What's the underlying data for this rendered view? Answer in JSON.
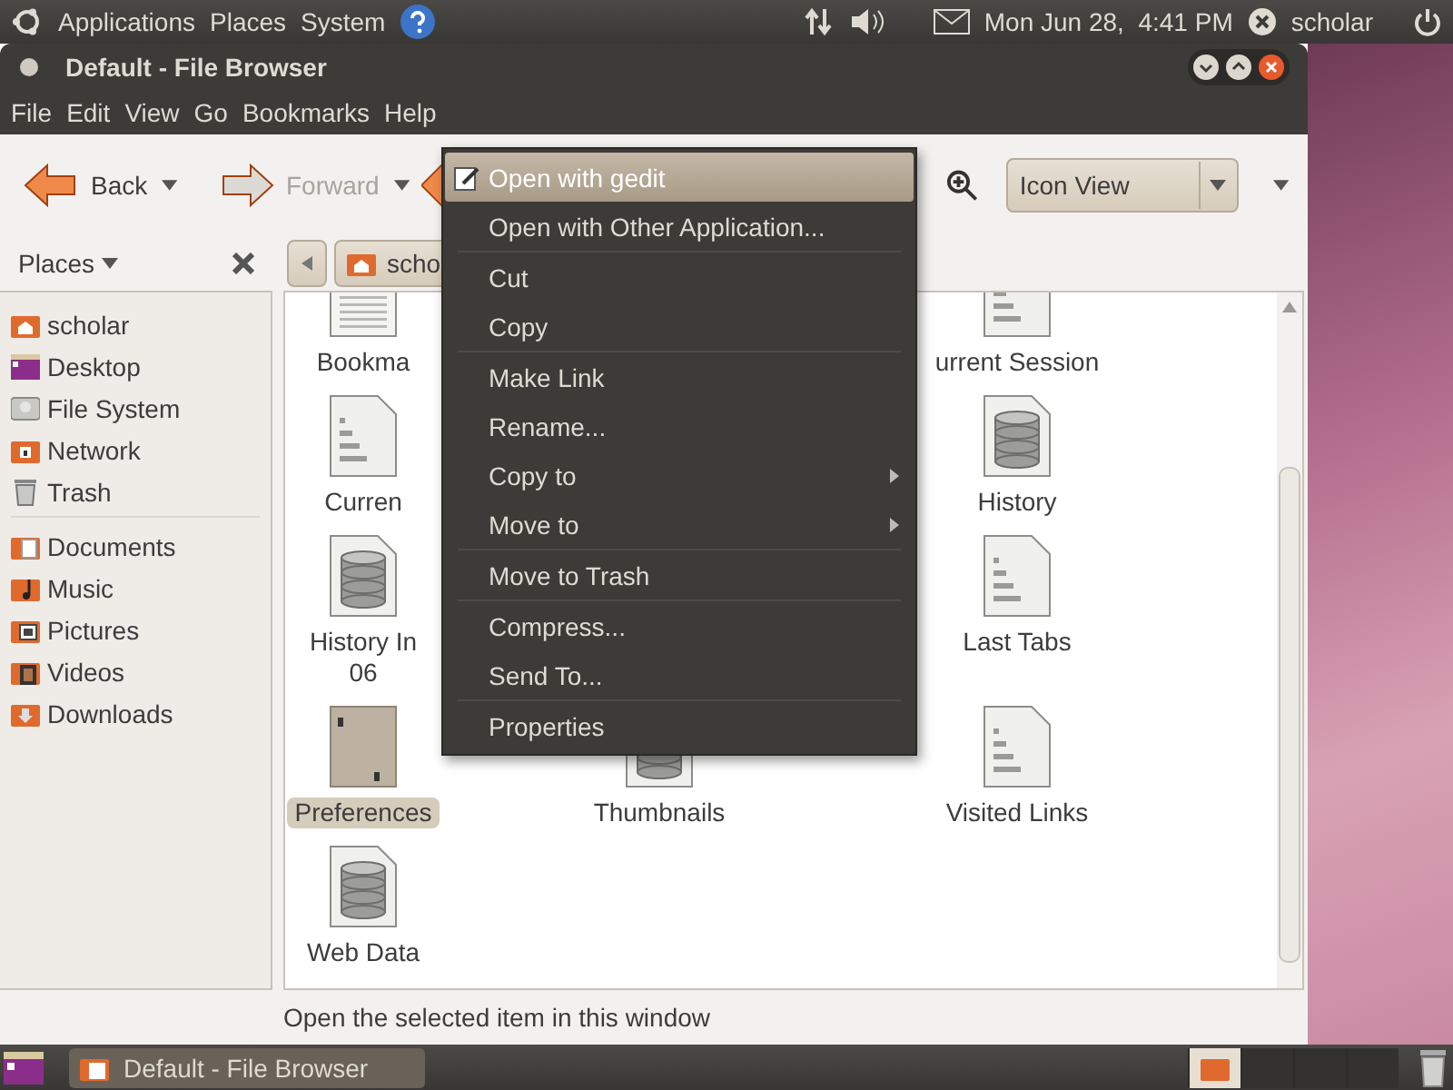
{
  "top_panel": {
    "menus": [
      "Applications",
      "Places",
      "System"
    ],
    "clock": "Mon Jun 28,  4:41 PM",
    "user": "scholar"
  },
  "window": {
    "title": "Default - File Browser"
  },
  "menu_bar": [
    "File",
    "Edit",
    "View",
    "Go",
    "Bookmarks",
    "Help"
  ],
  "toolbar": {
    "buttons": [
      {
        "label": "Back",
        "disabled": false
      },
      {
        "label": "Forward",
        "disabled": true
      }
    ],
    "view_mode": "Icon View"
  },
  "location": {
    "path_button": "scho"
  },
  "sidebar": {
    "title": "Places",
    "items": [
      {
        "kind": "home",
        "label": "scholar"
      },
      {
        "kind": "desktop",
        "label": "Desktop"
      },
      {
        "kind": "drive",
        "label": "File System"
      },
      {
        "kind": "network",
        "label": "Network"
      },
      {
        "kind": "trash",
        "label": "Trash"
      },
      {
        "kind": "separator"
      },
      {
        "kind": "documents",
        "label": "Documents"
      },
      {
        "kind": "music",
        "label": "Music"
      },
      {
        "kind": "pictures",
        "label": "Pictures"
      },
      {
        "kind": "videos",
        "label": "Videos"
      },
      {
        "kind": "downloads",
        "label": "Downloads"
      }
    ]
  },
  "icon_view": {
    "rows": [
      {
        "column_1": {
          "kind": "text",
          "label": "Bookma",
          "selected": false
        },
        "column_3": {
          "kind": "binary",
          "label": "urrent Session",
          "selected": false
        }
      },
      {
        "column_1": {
          "kind": "binary",
          "label": "Curren",
          "selected": false
        },
        "column_3": {
          "kind": "database",
          "label": "History",
          "selected": false
        }
      },
      {
        "column_1": {
          "kind": "database",
          "label": "History In\n06",
          "selected": false
        },
        "column_3": {
          "kind": "binary",
          "label": "Last Tabs",
          "selected": false
        }
      },
      {
        "column_1": {
          "kind": "json",
          "label": "Preferences",
          "selected": true
        },
        "column_2": {
          "kind": "database",
          "label": "Thumbnails",
          "selected": false
        },
        "column_3": {
          "kind": "binary",
          "label": "Visited Links",
          "selected": false
        }
      },
      {
        "column_1": {
          "kind": "database",
          "label": "Web Data",
          "selected": false
        }
      }
    ]
  },
  "status_bar": "Open the selected item in this window",
  "context_menu": {
    "items": [
      {
        "kind": "item",
        "label": "Open with gedit",
        "selected": true,
        "icon": true,
        "submenu": false
      },
      {
        "kind": "item",
        "label": "Open with Other Application...",
        "selected": false,
        "icon": false,
        "submenu": false
      },
      {
        "kind": "separator"
      },
      {
        "kind": "item",
        "label": "Cut",
        "selected": false,
        "icon": false,
        "submenu": false
      },
      {
        "kind": "item",
        "label": "Copy",
        "selected": false,
        "icon": false,
        "submenu": false
      },
      {
        "kind": "separator"
      },
      {
        "kind": "item",
        "label": "Make Link",
        "selected": false,
        "icon": false,
        "submenu": false
      },
      {
        "kind": "item",
        "label": "Rename...",
        "selected": false,
        "icon": false,
        "submenu": false
      },
      {
        "kind": "item",
        "label": "Copy to",
        "selected": false,
        "icon": false,
        "submenu": true
      },
      {
        "kind": "item",
        "label": "Move to",
        "selected": false,
        "icon": false,
        "submenu": true
      },
      {
        "kind": "separator"
      },
      {
        "kind": "item",
        "label": "Move to Trash",
        "selected": false,
        "icon": false,
        "submenu": false
      },
      {
        "kind": "separator"
      },
      {
        "kind": "item",
        "label": "Compress...",
        "selected": false,
        "icon": false,
        "submenu": false
      },
      {
        "kind": "item",
        "label": "Send To...",
        "selected": false,
        "icon": false,
        "submenu": false
      },
      {
        "kind": "separator"
      },
      {
        "kind": "item",
        "label": "Properties",
        "selected": false,
        "icon": false,
        "submenu": false
      }
    ]
  },
  "taskbar": {
    "tasks": [
      {
        "label": "Default - File Browser",
        "selected": true
      }
    ]
  }
}
